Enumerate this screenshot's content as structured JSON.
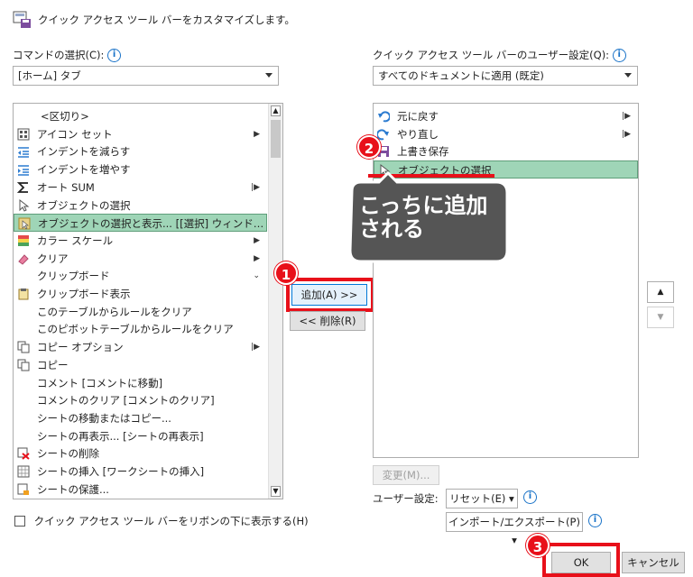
{
  "header": {
    "title": "クイック アクセス ツール バーをカスタマイズします。"
  },
  "left": {
    "label": "コマンドの選択(C):",
    "dropdown_value": "[ホーム] タブ",
    "items": [
      {
        "label": "<区切り>",
        "icon": "none",
        "sub": ""
      },
      {
        "label": "アイコン セット",
        "icon": "icon-set-icon",
        "sub": "▶"
      },
      {
        "label": "インデントを減らす",
        "icon": "indent-decrease-icon",
        "sub": ""
      },
      {
        "label": "インデントを増やす",
        "icon": "indent-increase-icon",
        "sub": ""
      },
      {
        "label": "オート SUM",
        "icon": "sigma-icon",
        "sub": "|▶"
      },
      {
        "label": "オブジェクトの選択",
        "icon": "cursor-icon",
        "sub": ""
      },
      {
        "label": "オブジェクトの選択と表示... [[選択] ウィンド…",
        "icon": "selection-pane-icon",
        "sub": ""
      },
      {
        "label": "カラー スケール",
        "icon": "color-scale-icon",
        "sub": "▶"
      },
      {
        "label": "クリア",
        "icon": "eraser-icon",
        "sub": "▶"
      },
      {
        "label": "クリップボード",
        "icon": "none",
        "sub": "⌄"
      },
      {
        "label": "クリップボード表示",
        "icon": "clipboard-icon",
        "sub": ""
      },
      {
        "label": "このテーブルからルールをクリア",
        "icon": "none",
        "sub": ""
      },
      {
        "label": "このピボットテーブルからルールをクリア",
        "icon": "none",
        "sub": ""
      },
      {
        "label": "コピー オプション",
        "icon": "copy-icon",
        "sub": "|▶"
      },
      {
        "label": "コピー",
        "icon": "copy-icon",
        "sub": ""
      },
      {
        "label": "コメント [コメントに移動]",
        "icon": "none",
        "sub": ""
      },
      {
        "label": "コメントのクリア [コメントのクリア]",
        "icon": "none",
        "sub": ""
      },
      {
        "label": "シートの移動またはコピー...",
        "icon": "none",
        "sub": ""
      },
      {
        "label": "シートの再表示... [シートの再表示]",
        "icon": "none",
        "sub": ""
      },
      {
        "label": "シートの削除",
        "icon": "sheet-delete-icon",
        "sub": ""
      },
      {
        "label": "シートの挿入 [ワークシートの挿入]",
        "icon": "sheet-insert-icon",
        "sub": ""
      },
      {
        "label": "シートの保護...",
        "icon": "sheet-protect-icon",
        "sub": ""
      }
    ],
    "checkbox_label": "クイック アクセス ツール バーをリボンの下に表示する(H)"
  },
  "middle": {
    "add_label": "追加(A) >>",
    "remove_label": "<< 削除(R)"
  },
  "right": {
    "label": "クイック アクセス ツール バーのユーザー設定(Q):",
    "dropdown_value": "すべてのドキュメントに適用 (既定)",
    "items": [
      {
        "label": "元に戻す",
        "icon": "undo-icon",
        "sub": "|▶"
      },
      {
        "label": "やり直し",
        "icon": "redo-icon",
        "sub": "|▶"
      },
      {
        "label": "上書き保存",
        "icon": "save-icon",
        "sub": ""
      },
      {
        "label": "オブジェクトの選択",
        "icon": "cursor-icon",
        "sub": ""
      }
    ],
    "modify_label": "変更(M)...",
    "user_settings_label": "ユーザー設定:",
    "reset_label": "リセット(E) ▾",
    "import_export_label": "インポート/エクスポート(P) ▾"
  },
  "footer": {
    "ok_label": "OK",
    "cancel_label": "キャンセル"
  },
  "annotations": {
    "callout_text": "こっちに追加\nされる",
    "badges": [
      "1",
      "2",
      "3"
    ],
    "accent_red": "#e8101a",
    "selection_green": "#9fd5b7"
  }
}
